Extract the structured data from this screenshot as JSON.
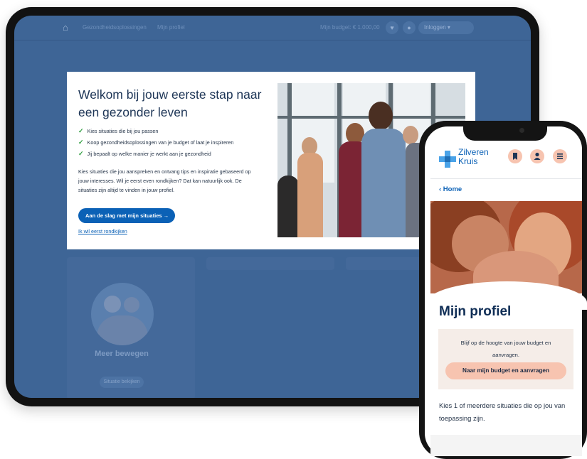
{
  "tablet": {
    "nav": {
      "item_1": "Gezondheidsoplossingen",
      "item_2": "Mijn profiel",
      "budget_label": "Mijn budget: € 1.000,00",
      "user_label": "Inloggen"
    },
    "modal": {
      "title": "Welkom bij jouw eerste stap naar een gezonder leven",
      "checks": [
        "Kies situaties die bij jou passen",
        "Koop gezondheidsoplossingen van je budget of laat je inspireren",
        "Jij bepaalt op welke manier je werkt aan je gezondheid"
      ],
      "body": "Kies situaties die jou aanspreken en ontvang tips en inspiratie gebaseerd op jouw interesses. Wil je eerst even rondkijken? Dat kan natuurlijk ook. De situaties zijn altijd te vinden in jouw profiel.",
      "cta_label": "Aan de slag met mijn situaties →",
      "secondary_link": "Ik wil eerst rondkijken"
    },
    "background_card": {
      "title": "Meer bewegen",
      "button_label": "Situatie bekijken"
    }
  },
  "phone": {
    "brand": {
      "line_1": "Zilveren",
      "line_2": "Kruis"
    },
    "icons": [
      "bookmark-icon",
      "user-icon",
      "menu-icon"
    ],
    "back_link": "‹ Home",
    "page_title": "Mijn profiel",
    "info_box": {
      "text": "Blijf op de hoogte van jouw budget en aanvragen.",
      "button_label": "Naar mijn budget en aanvragen"
    },
    "intro_text": "Kies 1 of meerdere situaties die op jou van toepassing zijn."
  },
  "colors": {
    "brand_blue": "#0b61b6",
    "tablet_overlay": "#3e6596",
    "accent_peach": "#f7c4b0",
    "check_green": "#2e9e3f",
    "heading_navy": "#0f2d55"
  }
}
